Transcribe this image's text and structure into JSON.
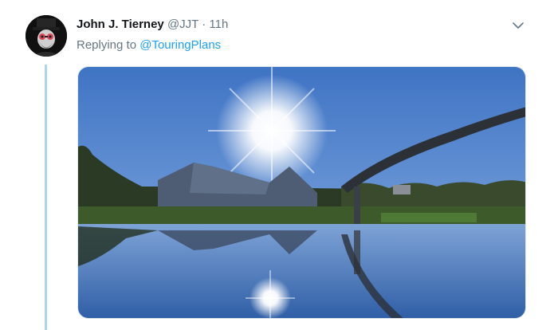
{
  "tweet": {
    "display_name": "John J. Tierney",
    "handle": "@JJT",
    "separator": "·",
    "time": "11h",
    "reply_prefix": "Replying to",
    "reply_to": "@TouringPlans"
  },
  "icons": {
    "more": "chevron-down-icon",
    "avatar": "avatar"
  },
  "colors": {
    "link": "#1da1f2",
    "muted": "#657786",
    "thread_line": "#a8d6ef"
  }
}
